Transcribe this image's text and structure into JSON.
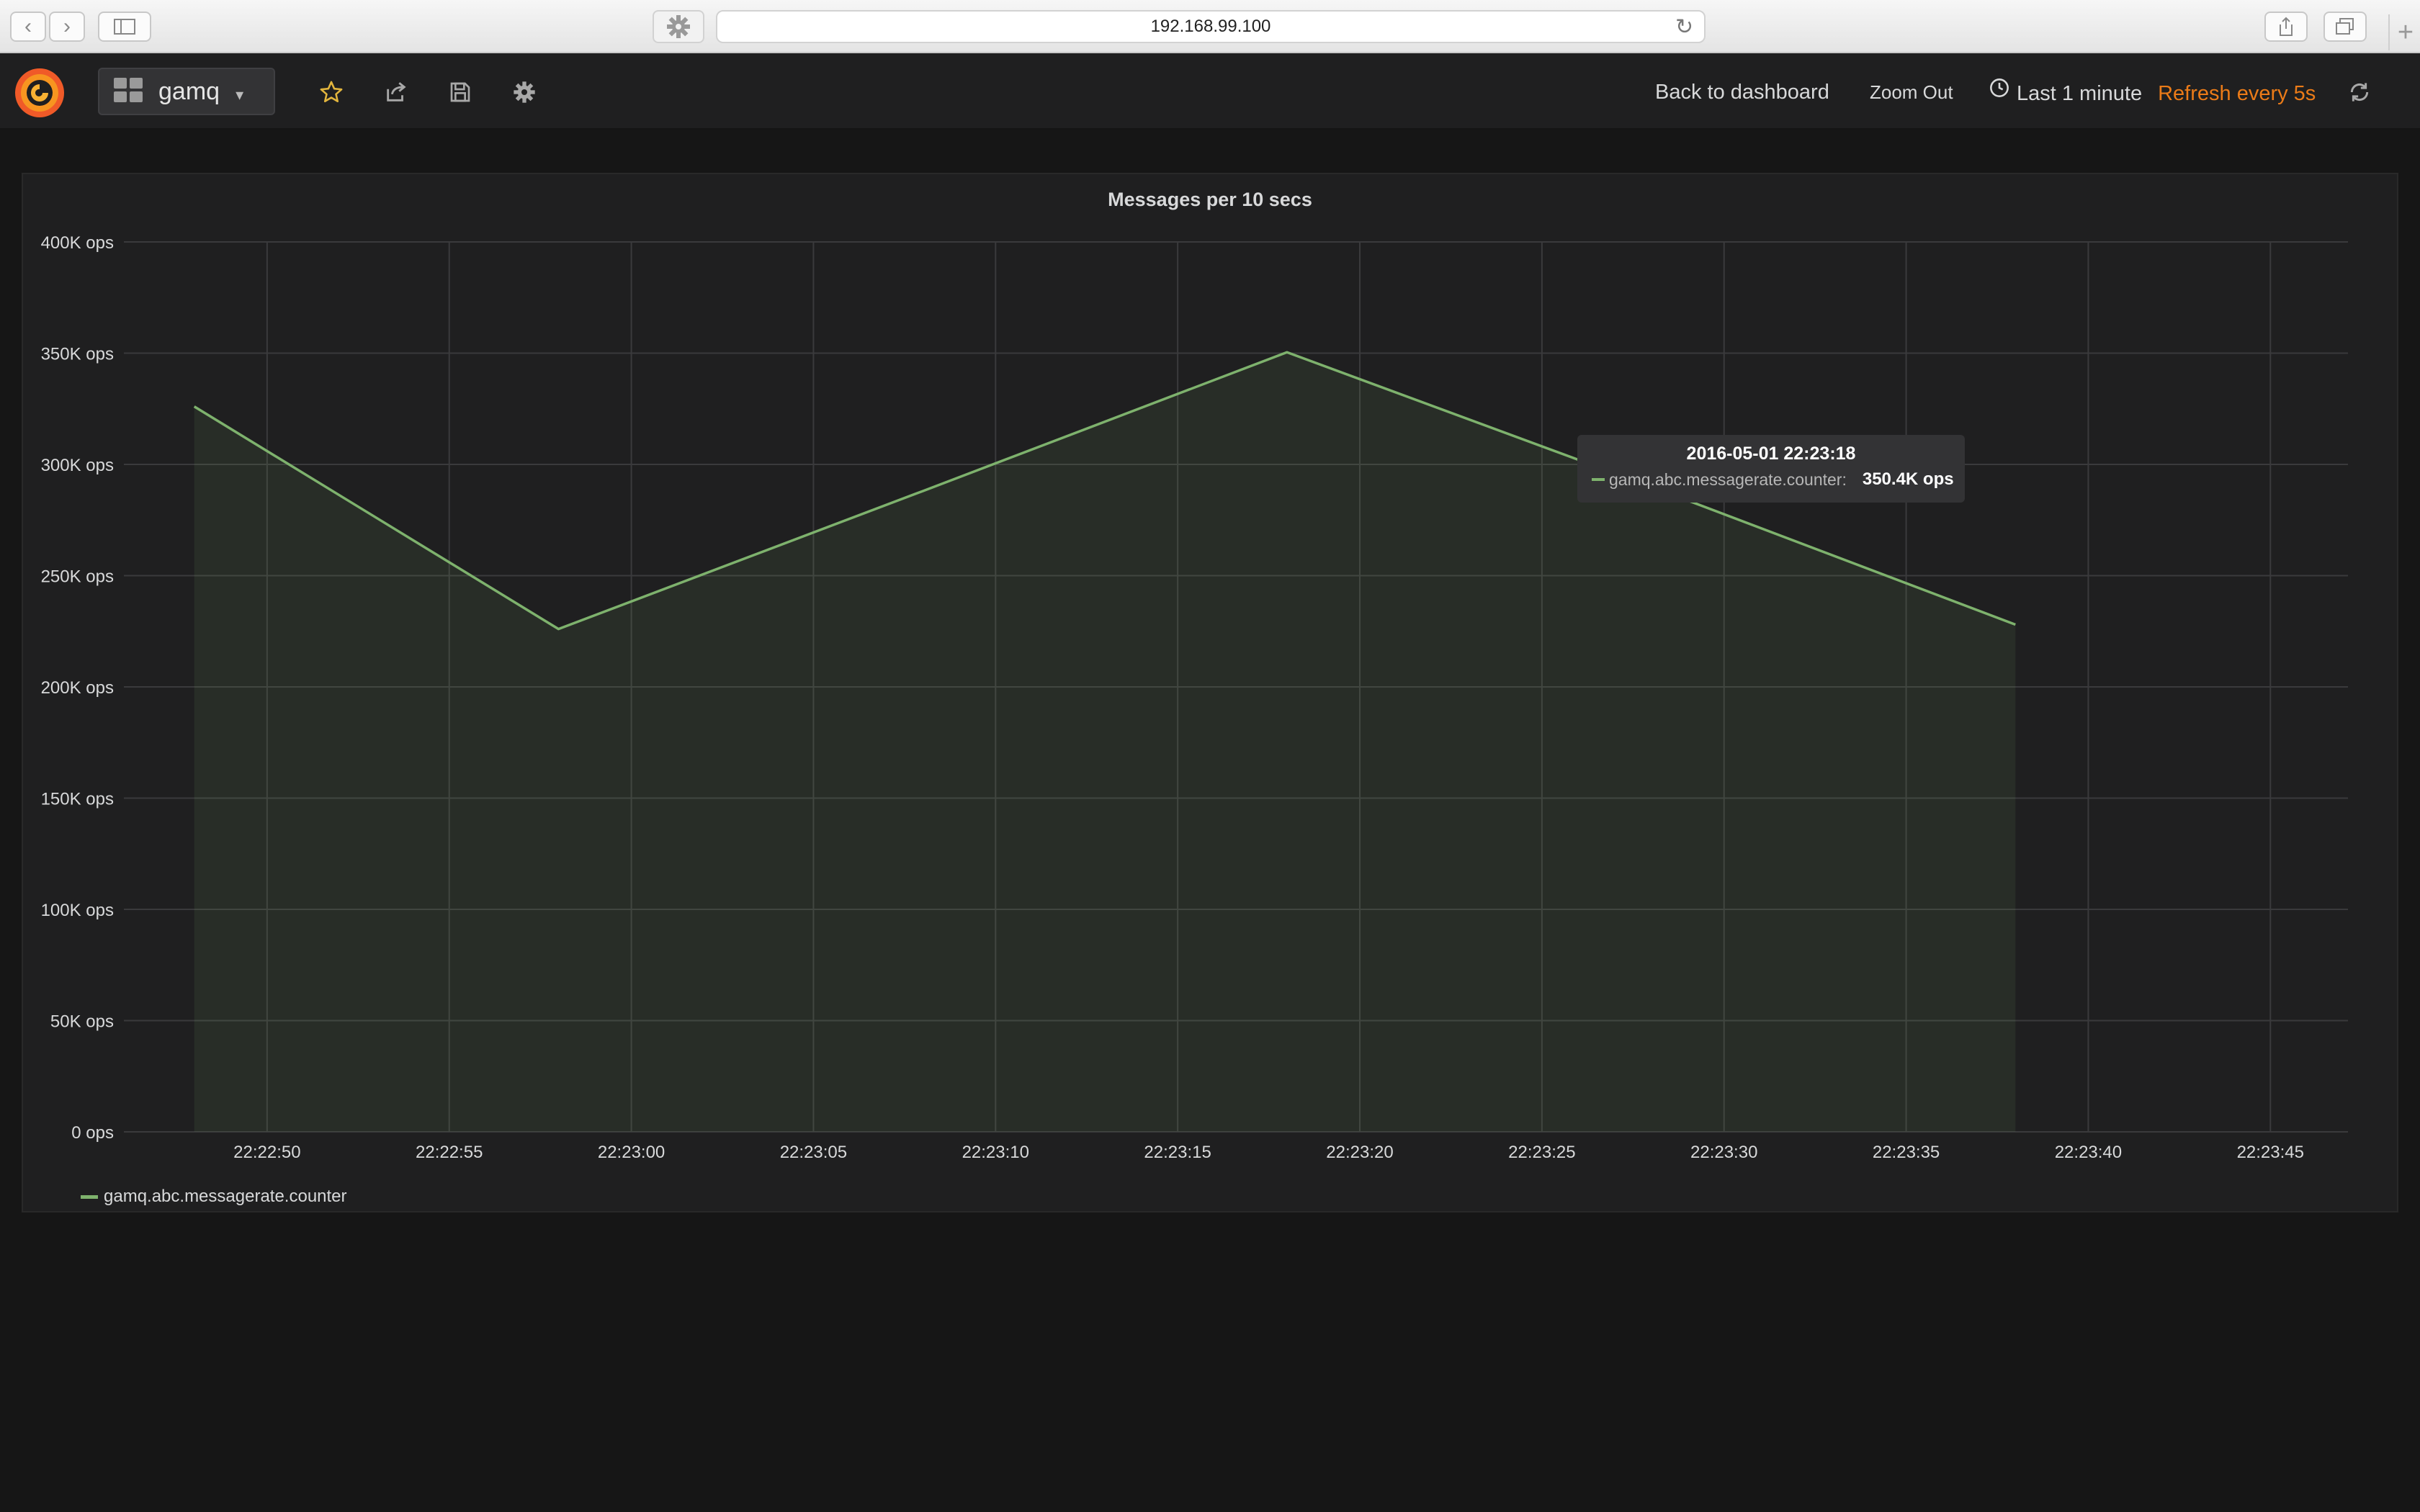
{
  "browser": {
    "url": "192.168.99.100"
  },
  "navbar": {
    "dashboard_title": "gamq",
    "back_to_dashboard": "Back to dashboard",
    "zoom_out": "Zoom Out",
    "time_range": "Last 1 minute",
    "refresh": "Refresh every 5s"
  },
  "colors": {
    "series": "#7eb26d",
    "refresh_accent": "#eb7b18",
    "star_accent": "#e2b53d"
  },
  "icons": [
    "grafana-logo",
    "dashboard-grid-icon",
    "star-icon",
    "share-icon",
    "save-icon",
    "gear-icon",
    "clock-icon",
    "refresh-icon"
  ],
  "chart_data": {
    "type": "area",
    "title": "Messages per 10 secs",
    "yunit": "ops",
    "ylim": [
      0,
      400000
    ],
    "y_ticks": [
      {
        "value": 400000,
        "label": "400K ops"
      },
      {
        "value": 350000,
        "label": "350K ops"
      },
      {
        "value": 300000,
        "label": "300K ops"
      },
      {
        "value": 250000,
        "label": "250K ops"
      },
      {
        "value": 200000,
        "label": "200K ops"
      },
      {
        "value": 150000,
        "label": "150K ops"
      },
      {
        "value": 100000,
        "label": "100K ops"
      },
      {
        "value": 50000,
        "label": "50K ops"
      },
      {
        "value": 0,
        "label": "0 ops"
      }
    ],
    "x_ticks": [
      "22:22:50",
      "22:22:55",
      "22:23:00",
      "22:23:05",
      "22:23:10",
      "22:23:15",
      "22:23:20",
      "22:23:25",
      "22:23:30",
      "22:23:35",
      "22:23:40",
      "22:23:45"
    ],
    "grid": true,
    "legend_position": "bottom-left",
    "series": [
      {
        "name": "gamq.abc.messagerate.counter",
        "x": [
          "22:22:48",
          "22:22:58",
          "22:23:08",
          "22:23:18",
          "22:23:28",
          "22:23:38"
        ],
        "values": [
          326000,
          226000,
          288000,
          350400,
          290000,
          228000
        ]
      }
    ],
    "tooltip": {
      "time": "2016-05-01 22:23:18",
      "series": "gamq.abc.messagerate.counter:",
      "value": "350.4K ops"
    }
  }
}
